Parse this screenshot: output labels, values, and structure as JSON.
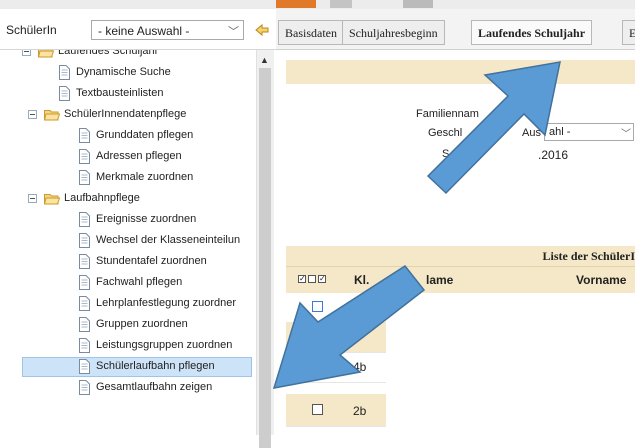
{
  "left_header": {
    "label": "SchülerIn",
    "select_value": "- keine Auswahl -"
  },
  "tree": {
    "items": [
      {
        "label": "Laufendes Schuljahr",
        "kind": "folder",
        "level": 0
      },
      {
        "label": "Dynamische Suche",
        "kind": "doc",
        "level": 1
      },
      {
        "label": "Textbausteinlisten",
        "kind": "doc",
        "level": 1
      },
      {
        "label": "SchülerInnendatenpflege",
        "kind": "folder",
        "level": 1
      },
      {
        "label": "Grunddaten pflegen",
        "kind": "doc",
        "level": 2
      },
      {
        "label": "Adressen pflegen",
        "kind": "doc",
        "level": 2
      },
      {
        "label": "Merkmale zuordnen",
        "kind": "doc",
        "level": 2
      },
      {
        "label": "Laufbahnpflege",
        "kind": "folder",
        "level": 1
      },
      {
        "label": "Ereignisse zuordnen",
        "kind": "doc",
        "level": 2
      },
      {
        "label": "Wechsel der Klasseneinteilun",
        "kind": "doc",
        "level": 2
      },
      {
        "label": "Stundentafel zuordnen",
        "kind": "doc",
        "level": 2
      },
      {
        "label": "Fachwahl pflegen",
        "kind": "doc",
        "level": 2
      },
      {
        "label": "Lehrplanfestlegung zuordner",
        "kind": "doc",
        "level": 2
      },
      {
        "label": "Gruppen zuordnen",
        "kind": "doc",
        "level": 2
      },
      {
        "label": "Leistungsgruppen zuordnen",
        "kind": "doc",
        "level": 2
      },
      {
        "label": "Schülerlaufbahn pflegen",
        "kind": "doc",
        "level": 2,
        "selected": true
      },
      {
        "label": "Gesamtlaufbahn zeigen",
        "kind": "doc",
        "level": 2
      }
    ]
  },
  "tabs": [
    {
      "label": "Basisdaten",
      "active": false
    },
    {
      "label": "Schuljahresbeginn",
      "active": false
    },
    {
      "label": "Laufendes Schuljahr",
      "active": true
    },
    {
      "label": "E",
      "active": false
    }
  ],
  "form": {
    "familienname_label": "Familiennam",
    "geschlecht_label": "Geschl",
    "geschlecht_value": "ahl -",
    "auswahl_fragment": "Aus",
    "date_label": "S",
    "date_value": ".2016"
  },
  "list": {
    "title": "Liste der SchülerI",
    "columns": {
      "kl": "Kl.",
      "name": "lame",
      "vorname": "Vorname"
    },
    "rows": [
      {
        "kl": ""
      },
      {
        "kl": ""
      },
      {
        "kl": "4b"
      },
      {
        "kl": "2b"
      }
    ]
  },
  "colors": {
    "tan": "#f5e8c8",
    "selected_bg": "#cde3f7",
    "arrow_blue": "#5b9bd5",
    "arrow_border": "#41719c"
  }
}
